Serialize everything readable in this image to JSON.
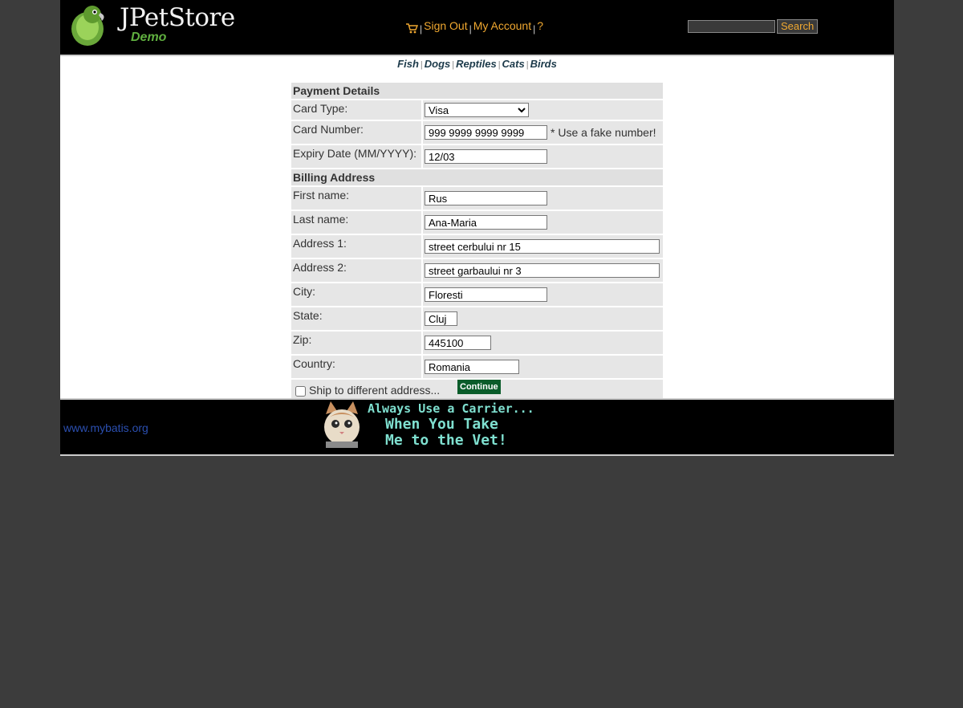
{
  "header": {
    "logo_brand": "JPetStore",
    "logo_sub": "Demo",
    "menu": {
      "cart_icon": "cart-icon",
      "sign_out": "Sign Out",
      "my_account": "My Account",
      "help": "?"
    },
    "search": {
      "value": "",
      "button": "Search"
    }
  },
  "quicklinks": [
    "Fish",
    "Dogs",
    "Reptiles",
    "Cats",
    "Birds"
  ],
  "form": {
    "payment_header": "Payment Details",
    "card_type_label": "Card Type:",
    "card_type_value": "Visa",
    "card_number_label": "Card Number:",
    "card_number_value": "999 9999 9999 9999",
    "card_number_hint": "* Use a fake number!",
    "expiry_label": "Expiry Date (MM/YYYY):",
    "expiry_value": "12/03",
    "billing_header": "Billing Address",
    "first_name_label": "First name:",
    "first_name_value": "Rus",
    "last_name_label": "Last name:",
    "last_name_value": "Ana-Maria",
    "address1_label": "Address 1:",
    "address1_value": "street cerbului nr 15",
    "address2_label": "Address 2:",
    "address2_value": "street garbaului nr 3",
    "city_label": "City:",
    "city_value": "Floresti",
    "state_label": "State:",
    "state_value": "Cluj",
    "zip_label": "Zip:",
    "zip_value": "445100",
    "country_label": "Country:",
    "country_value": "Romania",
    "ship_label": "Ship to different address...",
    "ship_checked": false,
    "continue": "Continue"
  },
  "footer": {
    "link": "www.mybatis.org",
    "banner_line1": "Always Use a Carrier...",
    "banner_line2": "When You Take",
    "banner_line3": "Me to the Vet!"
  },
  "colors": {
    "page_bg": "#3c3c3c",
    "header_bg": "#000000",
    "menu_link": "#f0a830",
    "continue_bg": "#0a5c2a",
    "footer_link": "#2b4fb0",
    "banner_text": "#7fe0d0"
  }
}
